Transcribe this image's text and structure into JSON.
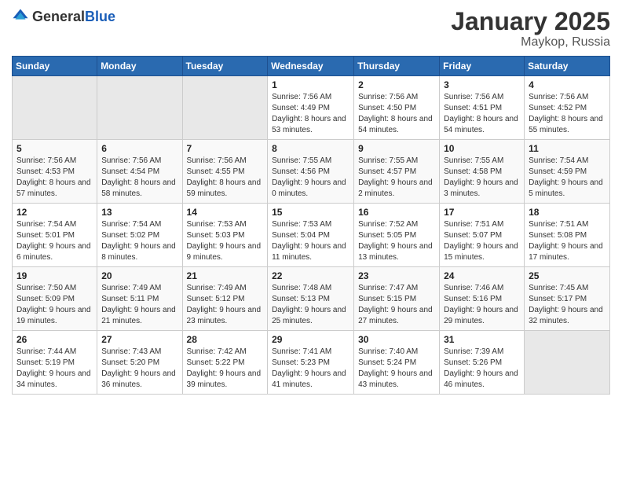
{
  "header": {
    "logo_general": "General",
    "logo_blue": "Blue",
    "month": "January 2025",
    "location": "Maykop, Russia"
  },
  "days_of_week": [
    "Sunday",
    "Monday",
    "Tuesday",
    "Wednesday",
    "Thursday",
    "Friday",
    "Saturday"
  ],
  "weeks": [
    [
      {
        "day": "",
        "empty": true
      },
      {
        "day": "",
        "empty": true
      },
      {
        "day": "",
        "empty": true
      },
      {
        "day": "1",
        "sunrise": "7:56 AM",
        "sunset": "4:49 PM",
        "daylight": "8 hours and 53 minutes."
      },
      {
        "day": "2",
        "sunrise": "7:56 AM",
        "sunset": "4:50 PM",
        "daylight": "8 hours and 54 minutes."
      },
      {
        "day": "3",
        "sunrise": "7:56 AM",
        "sunset": "4:51 PM",
        "daylight": "8 hours and 54 minutes."
      },
      {
        "day": "4",
        "sunrise": "7:56 AM",
        "sunset": "4:52 PM",
        "daylight": "8 hours and 55 minutes."
      }
    ],
    [
      {
        "day": "5",
        "sunrise": "7:56 AM",
        "sunset": "4:53 PM",
        "daylight": "8 hours and 57 minutes."
      },
      {
        "day": "6",
        "sunrise": "7:56 AM",
        "sunset": "4:54 PM",
        "daylight": "8 hours and 58 minutes."
      },
      {
        "day": "7",
        "sunrise": "7:56 AM",
        "sunset": "4:55 PM",
        "daylight": "8 hours and 59 minutes."
      },
      {
        "day": "8",
        "sunrise": "7:55 AM",
        "sunset": "4:56 PM",
        "daylight": "9 hours and 0 minutes."
      },
      {
        "day": "9",
        "sunrise": "7:55 AM",
        "sunset": "4:57 PM",
        "daylight": "9 hours and 2 minutes."
      },
      {
        "day": "10",
        "sunrise": "7:55 AM",
        "sunset": "4:58 PM",
        "daylight": "9 hours and 3 minutes."
      },
      {
        "day": "11",
        "sunrise": "7:54 AM",
        "sunset": "4:59 PM",
        "daylight": "9 hours and 5 minutes."
      }
    ],
    [
      {
        "day": "12",
        "sunrise": "7:54 AM",
        "sunset": "5:01 PM",
        "daylight": "9 hours and 6 minutes."
      },
      {
        "day": "13",
        "sunrise": "7:54 AM",
        "sunset": "5:02 PM",
        "daylight": "9 hours and 8 minutes."
      },
      {
        "day": "14",
        "sunrise": "7:53 AM",
        "sunset": "5:03 PM",
        "daylight": "9 hours and 9 minutes."
      },
      {
        "day": "15",
        "sunrise": "7:53 AM",
        "sunset": "5:04 PM",
        "daylight": "9 hours and 11 minutes."
      },
      {
        "day": "16",
        "sunrise": "7:52 AM",
        "sunset": "5:05 PM",
        "daylight": "9 hours and 13 minutes."
      },
      {
        "day": "17",
        "sunrise": "7:51 AM",
        "sunset": "5:07 PM",
        "daylight": "9 hours and 15 minutes."
      },
      {
        "day": "18",
        "sunrise": "7:51 AM",
        "sunset": "5:08 PM",
        "daylight": "9 hours and 17 minutes."
      }
    ],
    [
      {
        "day": "19",
        "sunrise": "7:50 AM",
        "sunset": "5:09 PM",
        "daylight": "9 hours and 19 minutes."
      },
      {
        "day": "20",
        "sunrise": "7:49 AM",
        "sunset": "5:11 PM",
        "daylight": "9 hours and 21 minutes."
      },
      {
        "day": "21",
        "sunrise": "7:49 AM",
        "sunset": "5:12 PM",
        "daylight": "9 hours and 23 minutes."
      },
      {
        "day": "22",
        "sunrise": "7:48 AM",
        "sunset": "5:13 PM",
        "daylight": "9 hours and 25 minutes."
      },
      {
        "day": "23",
        "sunrise": "7:47 AM",
        "sunset": "5:15 PM",
        "daylight": "9 hours and 27 minutes."
      },
      {
        "day": "24",
        "sunrise": "7:46 AM",
        "sunset": "5:16 PM",
        "daylight": "9 hours and 29 minutes."
      },
      {
        "day": "25",
        "sunrise": "7:45 AM",
        "sunset": "5:17 PM",
        "daylight": "9 hours and 32 minutes."
      }
    ],
    [
      {
        "day": "26",
        "sunrise": "7:44 AM",
        "sunset": "5:19 PM",
        "daylight": "9 hours and 34 minutes."
      },
      {
        "day": "27",
        "sunrise": "7:43 AM",
        "sunset": "5:20 PM",
        "daylight": "9 hours and 36 minutes."
      },
      {
        "day": "28",
        "sunrise": "7:42 AM",
        "sunset": "5:22 PM",
        "daylight": "9 hours and 39 minutes."
      },
      {
        "day": "29",
        "sunrise": "7:41 AM",
        "sunset": "5:23 PM",
        "daylight": "9 hours and 41 minutes."
      },
      {
        "day": "30",
        "sunrise": "7:40 AM",
        "sunset": "5:24 PM",
        "daylight": "9 hours and 43 minutes."
      },
      {
        "day": "31",
        "sunrise": "7:39 AM",
        "sunset": "5:26 PM",
        "daylight": "9 hours and 46 minutes."
      },
      {
        "day": "",
        "empty": true
      }
    ]
  ]
}
